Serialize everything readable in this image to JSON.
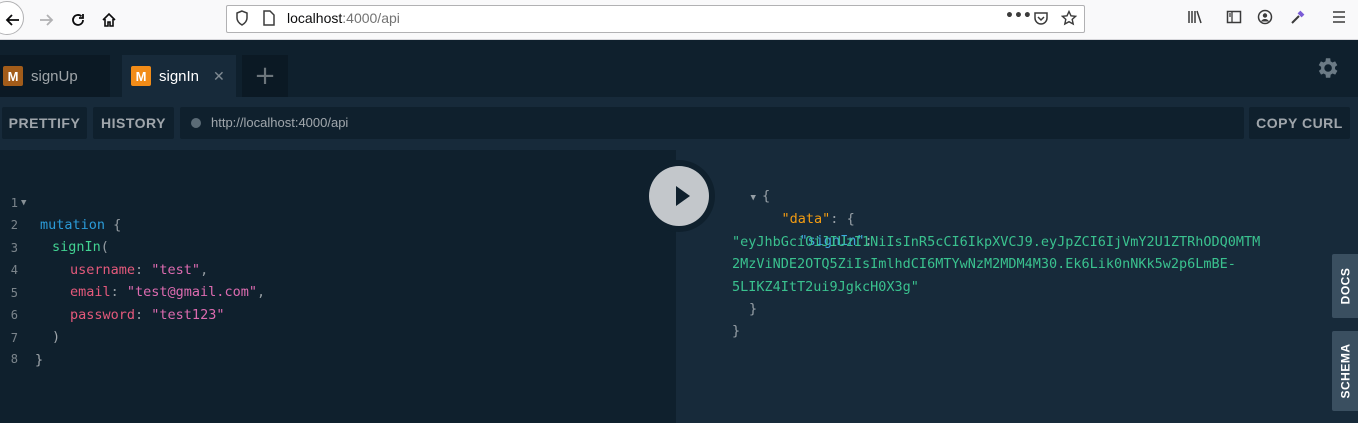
{
  "browser": {
    "url_host": "localhost",
    "url_rest": ":4000/api"
  },
  "tabs": [
    {
      "badge": "M",
      "label": "signUp"
    },
    {
      "badge": "M",
      "label": "signIn",
      "close": "✕"
    }
  ],
  "new_tab_label": "+",
  "controls": {
    "prettify": "PRETTIFY",
    "history": "HISTORY",
    "endpoint": "http://localhost:4000/api",
    "copy_curl": "COPY CURL"
  },
  "editor": {
    "line_numbers": [
      "1",
      "2",
      "3",
      "4",
      "5",
      "6",
      "7",
      "8"
    ],
    "l1_kw": "mutation",
    "l1_brace": "{",
    "l2_fn": "signIn",
    "l2_paren": "(",
    "l3_key": "username",
    "l3_val": "\"test\"",
    "l4_key": "email",
    "l4_val": "\"test@gmail.com\"",
    "l5_key": "password",
    "l5_val": "\"test123\"",
    "l6": ")",
    "l7": "}"
  },
  "result": {
    "open": "{",
    "data_key": "\"data\"",
    "data_brace": "{",
    "signin_key": "\"signIn\"",
    "token_1": "\"eyJhbGciOiJIUzI1NiIsInR5cCI6IkpXVCJ9.eyJpZCI6IjVmY2U1ZTRhODQ0MTM",
    "token_2": "2MzViNDE2OTQ5ZiIsImlhdCI6MTYwNzM2MDM4M30.Ek6Lik0nNKk5w2p6LmBE-",
    "token_3": "5LIKZ4ItT2ui9JgkcH0X3g\"",
    "inner_close": "}",
    "outer_close": "}"
  },
  "side_tabs": {
    "docs": "DOCS",
    "schema": "SCHEMA"
  }
}
